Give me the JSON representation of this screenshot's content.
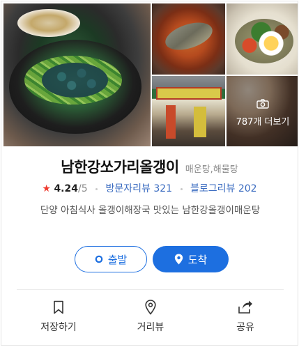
{
  "photos": {
    "more_label": "787개 더보기"
  },
  "place": {
    "name": "남한강쏘가리올갱이",
    "category": "매운탕,해물탕"
  },
  "stats": {
    "rating": "4.24",
    "rating_max": "/5",
    "visitor_reviews": "방문자리뷰 321",
    "blog_reviews": "블로그리뷰 202"
  },
  "description": "단양 아침식사 올갱이해장국 맛있는 남한강올갱이매운탕",
  "buttons": {
    "depart": "출발",
    "arrive": "도착"
  },
  "actions": [
    {
      "label": "저장하기",
      "icon": "bookmark-icon"
    },
    {
      "label": "거리뷰",
      "icon": "location-pin-icon"
    },
    {
      "label": "공유",
      "icon": "share-icon"
    }
  ],
  "colors": {
    "accent": "#1d6fe0",
    "star": "#ef3b2f",
    "link": "#3a6bc0"
  }
}
